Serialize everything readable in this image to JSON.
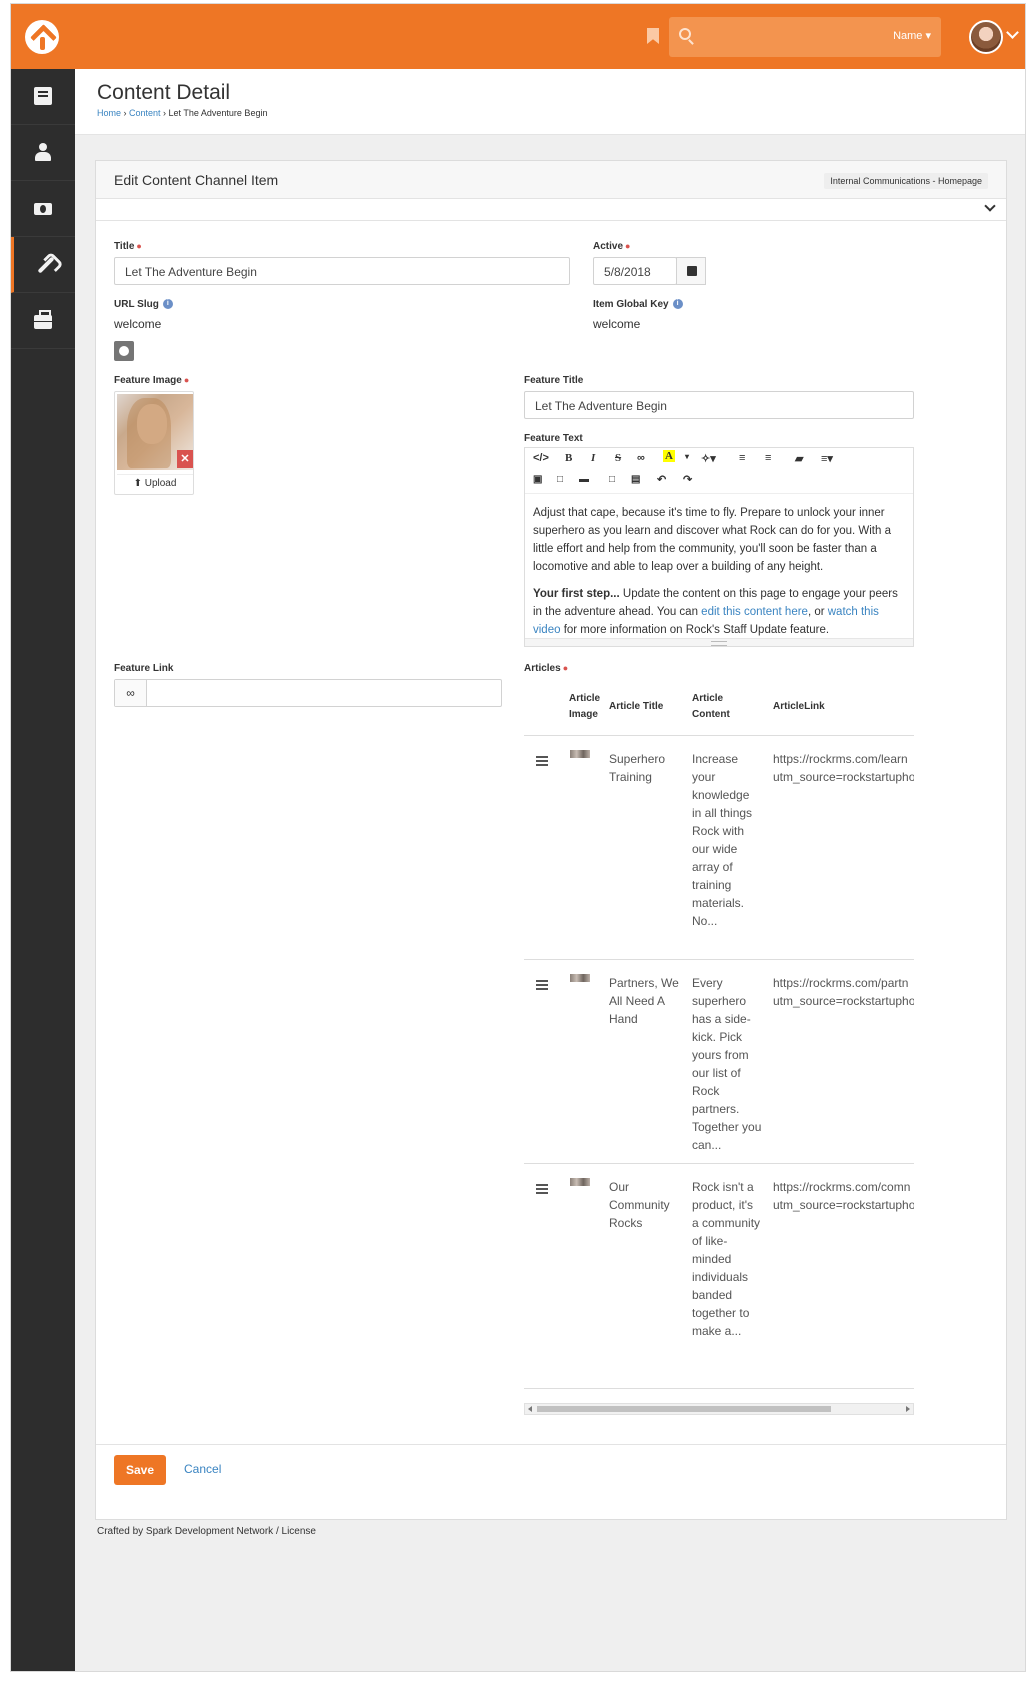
{
  "header": {
    "search_placeholder": "",
    "search_filter": "Name ▾"
  },
  "colors": {
    "accent": "#ee7625",
    "sidebar": "#2d2d2d",
    "link": "#3a84c1"
  },
  "sidebar": {
    "items": [
      {
        "icon": "book-icon"
      },
      {
        "icon": "person-icon"
      },
      {
        "icon": "money-icon"
      },
      {
        "icon": "wrench-icon",
        "active": true
      },
      {
        "icon": "briefcase-icon"
      }
    ]
  },
  "page": {
    "title": "Content Detail",
    "breadcrumb": [
      "Home",
      "Content",
      "Let The Adventure Begin"
    ]
  },
  "panel": {
    "title": "Edit Content Channel Item",
    "label": "Internal Communications - Homepage"
  },
  "form": {
    "title_label": "Title",
    "title_value": "Let The Adventure Begin",
    "active_label": "Active",
    "active_value": "5/8/2018",
    "url_slug_label": "URL Slug",
    "url_slug_value": "welcome",
    "global_key_label": "Item Global Key",
    "global_key_value": "welcome",
    "feature_image_label": "Feature Image",
    "upload_label": "Upload",
    "feature_title_label": "Feature Title",
    "feature_title_value": "Let The Adventure Begin",
    "feature_text_label": "Feature Text",
    "feature_text_p1": "Adjust that cape, because it's time to fly. Prepare to unlock your inner superhero as you learn and discover what Rock can do for you. With a little effort and help from the community, you'll soon be faster than a locomotive and able to leap over a building of any height.",
    "feature_text_p2_bold": "Your first step...",
    "feature_text_p2_a": " Update the content on this page to engage your peers in the adventure ahead. You can ",
    "feature_text_link1": "edit this content here",
    "feature_text_p2_b": ", or ",
    "feature_text_link2": "watch this video",
    "feature_text_p2_c": " for more information on Rock's Staff Update feature.",
    "feature_link_label": "Feature Link",
    "feature_link_value": "",
    "articles_label": "Articles"
  },
  "articles": {
    "headers": [
      "Article Image",
      "Article Title",
      "Article Content",
      "ArticleLink"
    ],
    "rows": [
      {
        "title": "Superhero Training",
        "content": "Increase your knowledge in all things Rock with our wide array of training materials. No...",
        "link1": "https://rockrms.com/learn",
        "link2": "utm_source=rockstartupho"
      },
      {
        "title": "Partners, We All Need A Hand",
        "content": "Every superhero has a side-kick. Pick yours from our list of Rock partners. Together you can...",
        "link1": "https://rockrms.com/partn",
        "link2": "utm_source=rockstartupho"
      },
      {
        "title": "Our Community Rocks",
        "content": "Rock isn't a product, it's a community of like-minded individuals banded together to make a...",
        "link1": "https://rockrms.com/comn",
        "link2": "utm_source=rockstartupho"
      }
    ]
  },
  "buttons": {
    "save": "Save",
    "cancel": "Cancel"
  },
  "footer": "Crafted by Spark Development Network / License"
}
